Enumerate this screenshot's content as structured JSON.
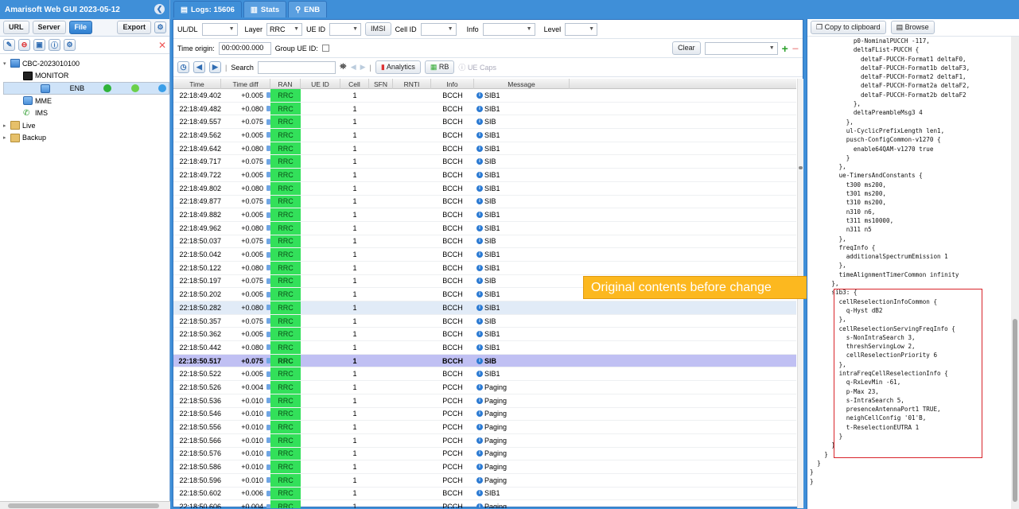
{
  "app": {
    "title": "Amarisoft Web GUI 2023-05-12"
  },
  "left_toolbar": {
    "url": "URL",
    "server": "Server",
    "file": "File",
    "export": "Export"
  },
  "tree": [
    {
      "label": "CBC-2023010100",
      "indent": 0,
      "icon": "server",
      "twisty": "▾"
    },
    {
      "label": "MONITOR",
      "indent": 1,
      "icon": "monitor"
    },
    {
      "label": "ENB",
      "indent": 1,
      "icon": "db",
      "selected": true
    },
    {
      "label": "MME",
      "indent": 1,
      "icon": "db"
    },
    {
      "label": "IMS",
      "indent": 1,
      "icon": "phone"
    },
    {
      "label": "Live",
      "indent": 0,
      "icon": "folder",
      "twisty": "▸"
    },
    {
      "label": "Backup",
      "indent": 0,
      "icon": "folder",
      "twisty": "▸"
    }
  ],
  "tabs": [
    {
      "label": "Logs: 15606",
      "icon": "logs-icon"
    },
    {
      "label": "Stats",
      "icon": "stats-icon"
    },
    {
      "label": "ENB",
      "icon": "enb-icon"
    }
  ],
  "filters": {
    "uldl": "UL/DL",
    "layer": "Layer",
    "layer_value": "RRC",
    "ueid": "UE ID",
    "imsi": "IMSI",
    "cellid": "Cell ID",
    "info": "Info",
    "level": "Level",
    "time_origin": "Time origin:",
    "time_origin_value": "00:00:00.000",
    "group_ue": "Group UE ID:",
    "clear": "Clear",
    "search": "Search",
    "analytics": "Analytics",
    "rb": "RB",
    "ue_caps": "UE Caps"
  },
  "columns": [
    "Time",
    "Time diff",
    "RAN",
    "UE ID",
    "Cell",
    "SFN",
    "RNTI",
    "Info",
    "Message"
  ],
  "rows": [
    [
      "22:18:49.402",
      "+0.005",
      "RRC",
      "",
      "1",
      "",
      "",
      "BCCH",
      "SIB1"
    ],
    [
      "22:18:49.482",
      "+0.080",
      "RRC",
      "",
      "1",
      "",
      "",
      "BCCH",
      "SIB1"
    ],
    [
      "22:18:49.557",
      "+0.075",
      "RRC",
      "",
      "1",
      "",
      "",
      "BCCH",
      "SIB"
    ],
    [
      "22:18:49.562",
      "+0.005",
      "RRC",
      "",
      "1",
      "",
      "",
      "BCCH",
      "SIB1"
    ],
    [
      "22:18:49.642",
      "+0.080",
      "RRC",
      "",
      "1",
      "",
      "",
      "BCCH",
      "SIB1"
    ],
    [
      "22:18:49.717",
      "+0.075",
      "RRC",
      "",
      "1",
      "",
      "",
      "BCCH",
      "SIB"
    ],
    [
      "22:18:49.722",
      "+0.005",
      "RRC",
      "",
      "1",
      "",
      "",
      "BCCH",
      "SIB1"
    ],
    [
      "22:18:49.802",
      "+0.080",
      "RRC",
      "",
      "1",
      "",
      "",
      "BCCH",
      "SIB1"
    ],
    [
      "22:18:49.877",
      "+0.075",
      "RRC",
      "",
      "1",
      "",
      "",
      "BCCH",
      "SIB"
    ],
    [
      "22:18:49.882",
      "+0.005",
      "RRC",
      "",
      "1",
      "",
      "",
      "BCCH",
      "SIB1"
    ],
    [
      "22:18:49.962",
      "+0.080",
      "RRC",
      "",
      "1",
      "",
      "",
      "BCCH",
      "SIB1"
    ],
    [
      "22:18:50.037",
      "+0.075",
      "RRC",
      "",
      "1",
      "",
      "",
      "BCCH",
      "SIB"
    ],
    [
      "22:18:50.042",
      "+0.005",
      "RRC",
      "",
      "1",
      "",
      "",
      "BCCH",
      "SIB1"
    ],
    [
      "22:18:50.122",
      "+0.080",
      "RRC",
      "",
      "1",
      "",
      "",
      "BCCH",
      "SIB1"
    ],
    [
      "22:18:50.197",
      "+0.075",
      "RRC",
      "",
      "1",
      "",
      "",
      "BCCH",
      "SIB"
    ],
    [
      "22:18:50.202",
      "+0.005",
      "RRC",
      "",
      "1",
      "",
      "",
      "BCCH",
      "SIB1"
    ],
    [
      "22:18:50.282",
      "+0.080",
      "RRC",
      "",
      "1",
      "",
      "",
      "BCCH",
      "SIB1"
    ],
    [
      "22:18:50.357",
      "+0.075",
      "RRC",
      "",
      "1",
      "",
      "",
      "BCCH",
      "SIB"
    ],
    [
      "22:18:50.362",
      "+0.005",
      "RRC",
      "",
      "1",
      "",
      "",
      "BCCH",
      "SIB1"
    ],
    [
      "22:18:50.442",
      "+0.080",
      "RRC",
      "",
      "1",
      "",
      "",
      "BCCH",
      "SIB1"
    ],
    [
      "22:18:50.517",
      "+0.075",
      "RRC",
      "",
      "1",
      "",
      "",
      "BCCH",
      "SIB"
    ],
    [
      "22:18:50.522",
      "+0.005",
      "RRC",
      "",
      "1",
      "",
      "",
      "BCCH",
      "SIB1"
    ],
    [
      "22:18:50.526",
      "+0.004",
      "RRC",
      "",
      "1",
      "",
      "",
      "PCCH",
      "Paging"
    ],
    [
      "22:18:50.536",
      "+0.010",
      "RRC",
      "",
      "1",
      "",
      "",
      "PCCH",
      "Paging"
    ],
    [
      "22:18:50.546",
      "+0.010",
      "RRC",
      "",
      "1",
      "",
      "",
      "PCCH",
      "Paging"
    ],
    [
      "22:18:50.556",
      "+0.010",
      "RRC",
      "",
      "1",
      "",
      "",
      "PCCH",
      "Paging"
    ],
    [
      "22:18:50.566",
      "+0.010",
      "RRC",
      "",
      "1",
      "",
      "",
      "PCCH",
      "Paging"
    ],
    [
      "22:18:50.576",
      "+0.010",
      "RRC",
      "",
      "1",
      "",
      "",
      "PCCH",
      "Paging"
    ],
    [
      "22:18:50.586",
      "+0.010",
      "RRC",
      "",
      "1",
      "",
      "",
      "PCCH",
      "Paging"
    ],
    [
      "22:18:50.596",
      "+0.010",
      "RRC",
      "",
      "1",
      "",
      "",
      "PCCH",
      "Paging"
    ],
    [
      "22:18:50.602",
      "+0.006",
      "RRC",
      "",
      "1",
      "",
      "",
      "BCCH",
      "SIB1"
    ],
    [
      "22:18:50.606",
      "+0.004",
      "RRC",
      "",
      "1",
      "",
      "",
      "PCCH",
      "Paging"
    ]
  ],
  "highlight_row": 16,
  "selected_row": 20,
  "annotation": "Original contents before change",
  "right_toolbar": {
    "copy": "Copy to clipboard",
    "browse": "Browse"
  },
  "code_lines": [
    "            p0-NominalPUCCH -117,",
    "            deltaFList-PUCCH {",
    "              deltaF-PUCCH-Format1 deltaF0,",
    "              deltaF-PUCCH-Format1b deltaF3,",
    "              deltaF-PUCCH-Format2 deltaF1,",
    "              deltaF-PUCCH-Format2a deltaF2,",
    "              deltaF-PUCCH-Format2b deltaF2",
    "            },",
    "            deltaPreambleMsg3 4",
    "          },",
    "          ul-CyclicPrefixLength len1,",
    "          pusch-ConfigCommon-v1270 {",
    "            enable64QAM-v1270 true",
    "          }",
    "        },",
    "        ue-TimersAndConstants {",
    "          t300 ms200,",
    "          t301 ms200,",
    "          t310 ms200,",
    "          n310 n6,",
    "          t311 ms10000,",
    "          n311 n5",
    "        },",
    "        freqInfo {",
    "          additionalSpectrumEmission 1",
    "        },",
    "        timeAlignmentTimerCommon infinity",
    "      },",
    "      sib3: {",
    "        cellReselectionInfoCommon {",
    "          q-Hyst dB2",
    "        },",
    "        cellReselectionServingFreqInfo {",
    "          s-NonIntraSearch 3,",
    "          threshServingLow 2,",
    "          cellReselectionPriority 6",
    "        },",
    "        intraFreqCellReselectionInfo {",
    "          q-RxLevMin -61,",
    "          p-Max 23,",
    "          s-IntraSearch 5,",
    "          presenceAntennaPort1 TRUE,",
    "          neighCellConfig '01'B,",
    "          t-ReselectionEUTRA 1",
    "        }",
    "      }",
    "    }",
    "  }",
    "}",
    "}"
  ]
}
